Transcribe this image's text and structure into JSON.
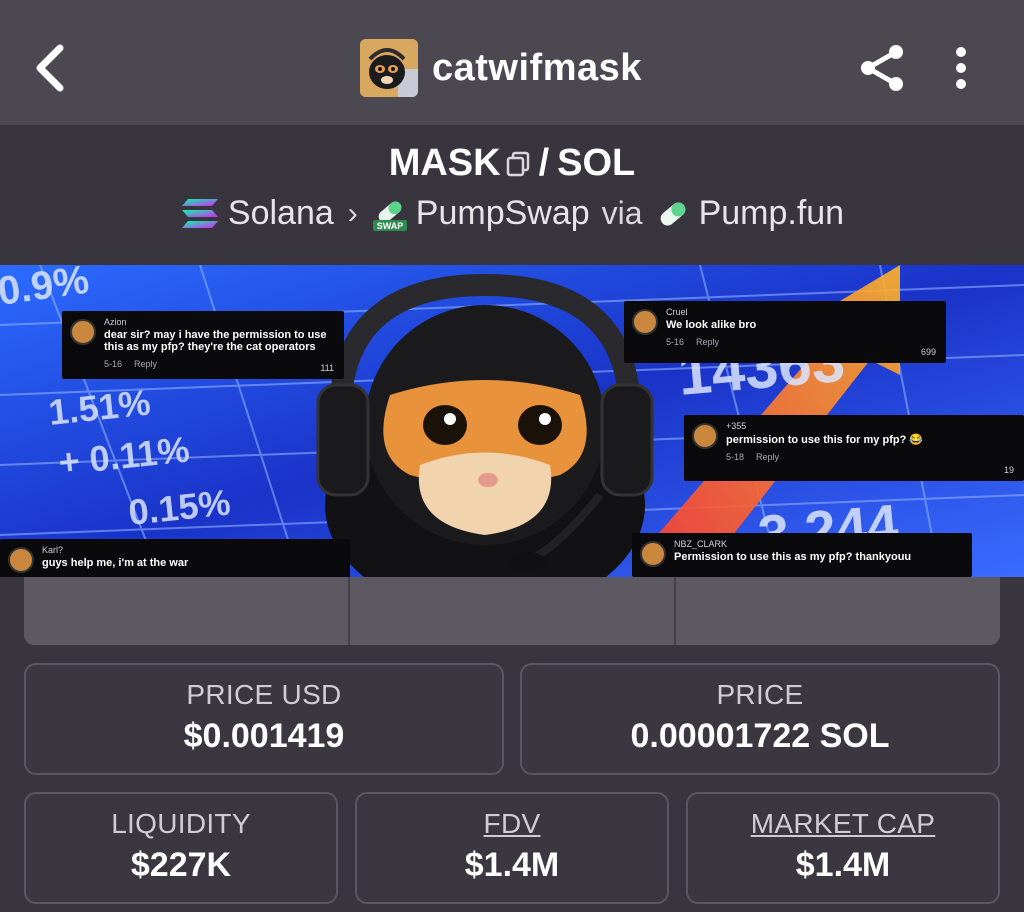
{
  "header": {
    "title": "catwifmask",
    "back_icon": "chevron-left-icon",
    "share_icon": "share-icon",
    "more_icon": "more-vertical-icon"
  },
  "pair": {
    "base": "MASK",
    "separator": "/",
    "quote": "SOL"
  },
  "route": {
    "chain": "Solana",
    "dex": "PumpSwap",
    "dex_badge": "SWAP",
    "via": "via",
    "launchpad": "Pump.fun"
  },
  "banner": {
    "comments": [
      {
        "user": "Azion",
        "text": "dear sir? may i have the permission to use this as my pfp? they're the cat operators",
        "date": "5-16",
        "reply": "Reply",
        "likes": "111"
      },
      {
        "user": "Cruel",
        "text": "We look alike bro",
        "date": "5-16",
        "reply": "Reply",
        "likes": "699"
      },
      {
        "user": "+355",
        "text": "permission to use this for my pfp? 😂",
        "date": "5-18",
        "reply": "Reply",
        "likes": "19"
      },
      {
        "user": "Karl?",
        "text": "guys help me, i'm at the war",
        "date": "",
        "reply": "",
        "likes": ""
      },
      {
        "user": "NBZ_CLARK",
        "text": "Permission to use this as my pfp? thankyouu",
        "date": "",
        "reply": "",
        "likes": ""
      }
    ],
    "ticker_text": [
      "0.9%",
      "1.51%",
      "+ 0.11%",
      "0.15%",
      "14363",
      "3,244"
    ]
  },
  "stats": {
    "price_usd": {
      "label": "PRICE USD",
      "value": "$0.001419"
    },
    "price": {
      "label": "PRICE",
      "value": "0.00001722 SOL"
    },
    "liquidity": {
      "label": "LIQUIDITY",
      "value": "$227K"
    },
    "fdv": {
      "label": "FDV",
      "value": "$1.4M"
    },
    "market_cap": {
      "label": "MARKET CAP",
      "value": "$1.4M"
    }
  },
  "colors": {
    "background": "#38353f",
    "topbar": "#4b4852",
    "card_border": "#5a5762",
    "banner_blue": "#1e3bd9"
  }
}
